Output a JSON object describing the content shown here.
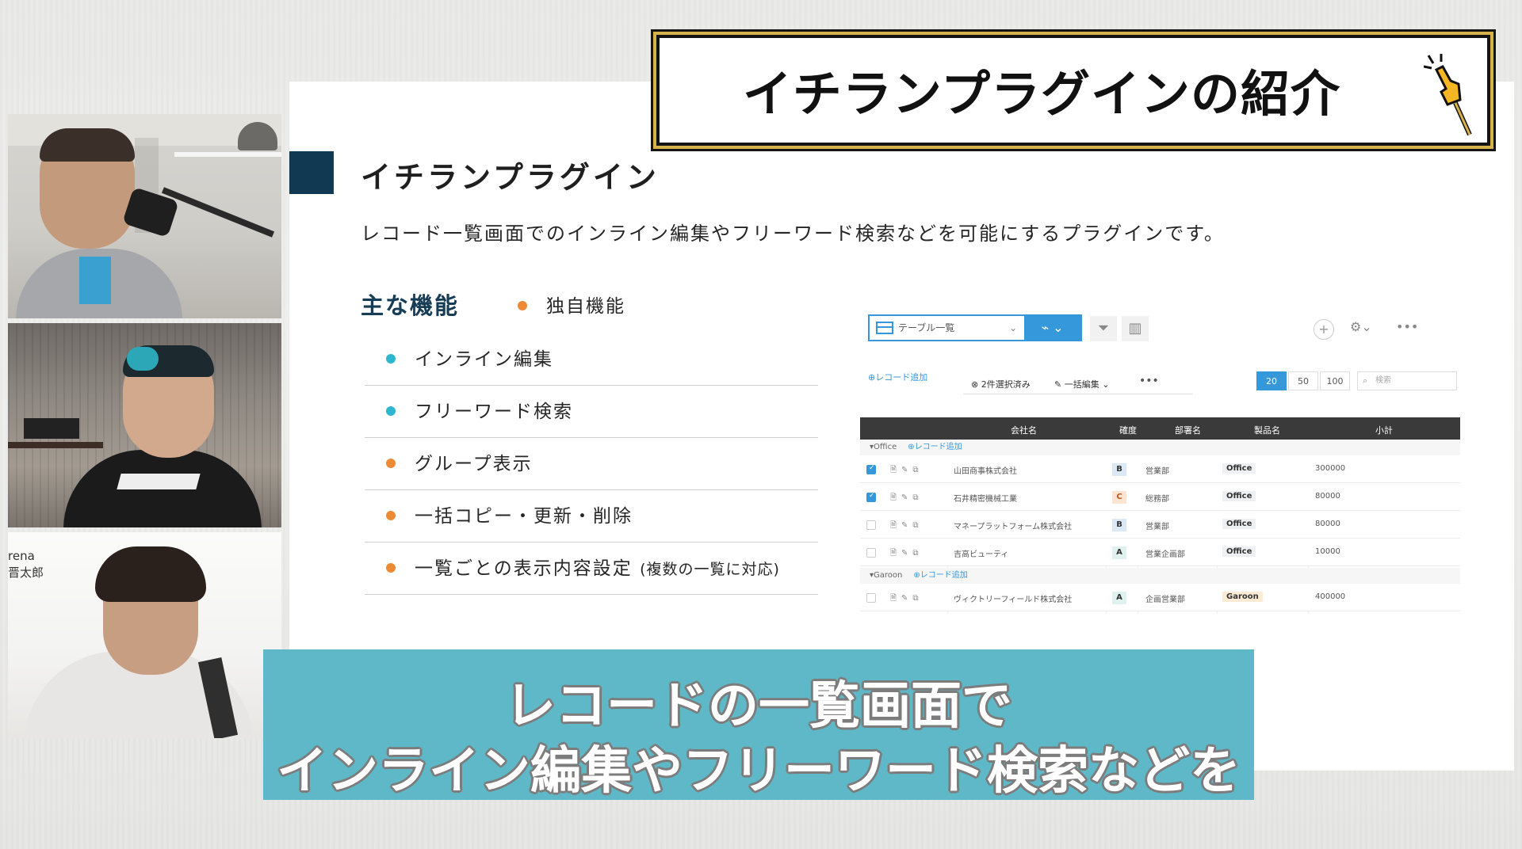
{
  "banner": {
    "title": "イチランプラグインの紹介"
  },
  "slide": {
    "title": "イチランプラグイン",
    "description": "レコード一覧画面でのインライン編集やフリーワード検索などを可能にするプラグインです。",
    "features_heading": "主な機能",
    "unique_label": "独自機能",
    "features": [
      {
        "label": "インライン編集",
        "color": "#2eb6cf"
      },
      {
        "label": "フリーワード検索",
        "color": "#2eb6cf"
      },
      {
        "label": "グループ表示",
        "color": "#ee8a35"
      },
      {
        "label": "一括コピー・更新・削除",
        "color": "#ee8a35"
      },
      {
        "label": "一覧ごとの表示内容設定",
        "note": "(複数の一覧に対応)",
        "color": "#ee8a35"
      }
    ]
  },
  "app": {
    "view_name": "テーブル一覧",
    "add_record": "レコード追加",
    "selected_info": "2件選択済み",
    "bulk_edit": "一括編集",
    "page_sizes": [
      "20",
      "50",
      "100"
    ],
    "active_page_size": "20",
    "search_placeholder": "検索",
    "columns": [
      "会社名",
      "確度",
      "部署名",
      "製品名",
      "小計"
    ],
    "groups": [
      {
        "name": "Office",
        "add_label": "レコード追加",
        "rows": [
          {
            "company": "山田商事株式会社",
            "rank": "B",
            "dept": "営業部",
            "product": "Office",
            "subtotal": "300000",
            "checked": true
          },
          {
            "company": "石井精密機械工業",
            "rank": "C",
            "dept": "総務部",
            "product": "Office",
            "subtotal": "80000",
            "checked": true
          },
          {
            "company": "マネープラットフォーム株式会社",
            "rank": "B",
            "dept": "営業部",
            "product": "Office",
            "subtotal": "80000",
            "checked": false
          },
          {
            "company": "吉高ビューティ",
            "rank": "A",
            "dept": "営業企画部",
            "product": "Office",
            "subtotal": "10000",
            "checked": false
          }
        ]
      },
      {
        "name": "Garoon",
        "add_label": "レコード追加",
        "rows": [
          {
            "company": "ヴィクトリーフィールド株式会社",
            "rank": "A",
            "dept": "企画営業部",
            "product": "Garoon",
            "subtotal": "400000",
            "checked": false
          }
        ]
      }
    ]
  },
  "participants": {
    "name_partial_1": "rena",
    "name_partial_2": "晋太郎"
  },
  "caption": {
    "line1": "レコードの一覧画面で",
    "line2": "インライン編集やフリーワード検索などを"
  }
}
